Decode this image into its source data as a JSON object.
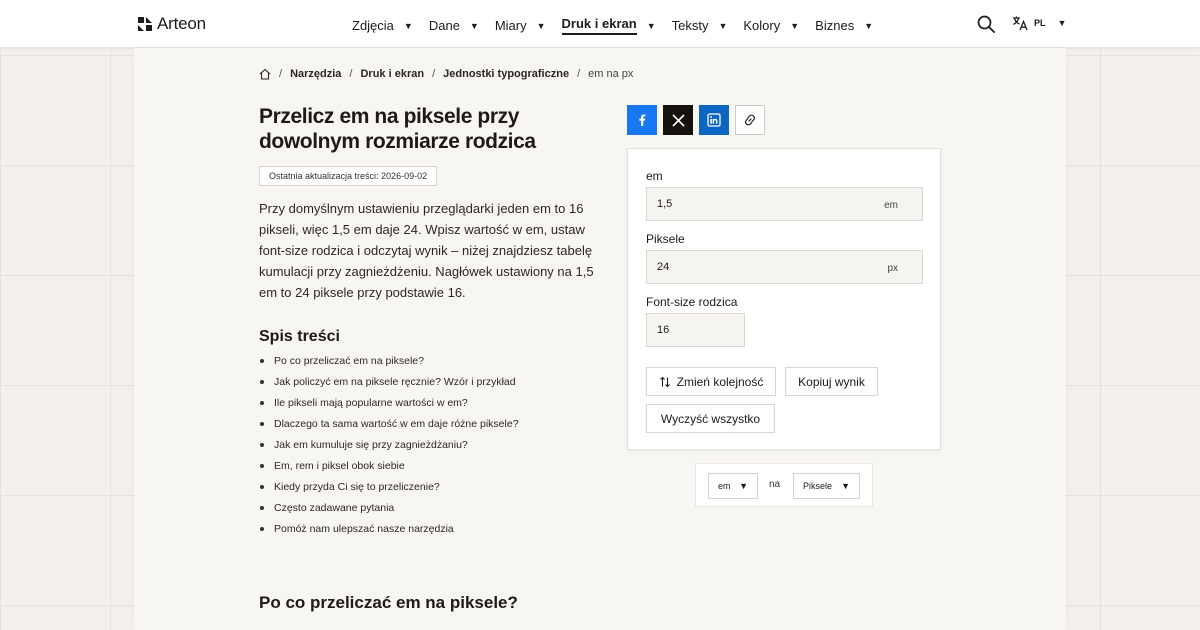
{
  "header": {
    "brand": "Arteon",
    "nav": [
      {
        "label": "Zdjęcia"
      },
      {
        "label": "Dane"
      },
      {
        "label": "Miary"
      },
      {
        "label": "Druk i ekran",
        "active": true
      },
      {
        "label": "Teksty"
      },
      {
        "label": "Kolory"
      },
      {
        "label": "Biznes"
      }
    ],
    "language": "PL"
  },
  "breadcrumb": {
    "items": [
      "Narzędzia",
      "Druk i ekran",
      "Jednostki typograficzne"
    ],
    "current": "em na px"
  },
  "article": {
    "title": "Przelicz em na piksele przy dowolnym rozmiarze rodzica",
    "updated": "Ostatnia aktualizacja treści: 2026-09-02",
    "intro": "Przy domyślnym ustawieniu przeglądarki jeden em to 16 pikseli, więc 1,5 em daje 24. Wpisz wartość w em, ustaw font-size rodzica i odczytaj wynik – niżej znajdziesz tabelę kumulacji przy zagnieżdżeniu. Nagłówek ustawiony na 1,5 em to 24 piksele przy podstawie 16.",
    "toc_title": "Spis treści",
    "toc": [
      "Po co przeliczać em na piksele?",
      "Jak policzyć em na piksele ręcznie? Wzór i przykład",
      "Ile pikseli mają popularne wartości w em?",
      "Dlaczego ta sama wartość w em daje różne piksele?",
      "Jak em kumuluje się przy zagnieżdżaniu?",
      "Em, rem i piksel obok siebie",
      "Kiedy przyda Ci się to przeliczenie?",
      "Często zadawane pytania",
      "Pomóż nam ulepszać nasze narzędzia"
    ],
    "section_title": "Po co przeliczać em na piksele?"
  },
  "converter": {
    "em_label": "em",
    "em_value": "1,5",
    "em_unit": "em",
    "px_label": "Piksele",
    "px_value": "24",
    "px_unit": "px",
    "parent_label": "Font-size rodzica",
    "parent_value": "16",
    "swap_label": "Zmień kolejność",
    "copy_label": "Kopiuj wynik",
    "clear_label": "Wyczyść wszystko"
  },
  "unit_selector": {
    "from": "em",
    "middle": "na",
    "to": "Piksele"
  },
  "colors": {
    "facebook": "#1877f2",
    "x": "#14110e",
    "linkedin": "#0a66c2"
  }
}
